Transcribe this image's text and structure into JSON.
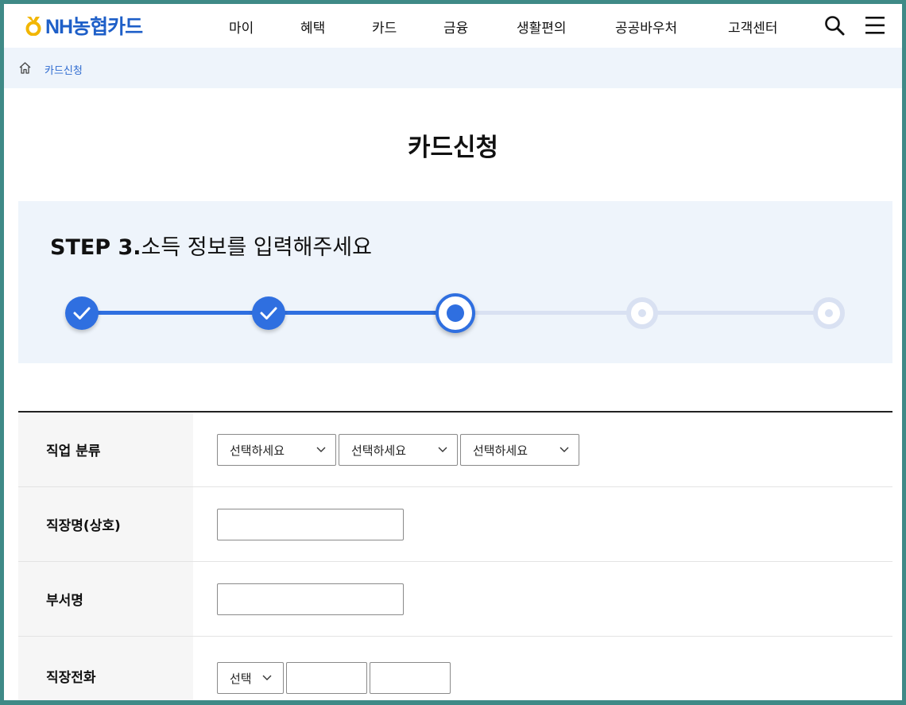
{
  "header": {
    "logo_text": "NH농협카드",
    "nav": [
      "마이",
      "혜택",
      "카드",
      "금융",
      "생활편의",
      "공공바우처",
      "고객센터"
    ]
  },
  "breadcrumb": {
    "current": "카드신청"
  },
  "page_title": "카드신청",
  "step": {
    "prefix": "STEP 3.",
    "title": "소득 정보를 입력해주세요",
    "total": 5,
    "current": 3
  },
  "form": {
    "job_category": {
      "label": "직업 분류",
      "selects": [
        "선택하세요",
        "선택하세요",
        "선택하세요"
      ]
    },
    "company_name": {
      "label": "직장명(상호)",
      "value": ""
    },
    "department": {
      "label": "부서명",
      "value": ""
    },
    "work_phone": {
      "label": "직장전화",
      "area_select": "선택",
      "mid": "",
      "last": ""
    }
  },
  "colors": {
    "primary": "#2f6fe0",
    "panel": "#eef4fb",
    "logo": "#1e5fc8",
    "logo_mark": "#f2b600"
  }
}
